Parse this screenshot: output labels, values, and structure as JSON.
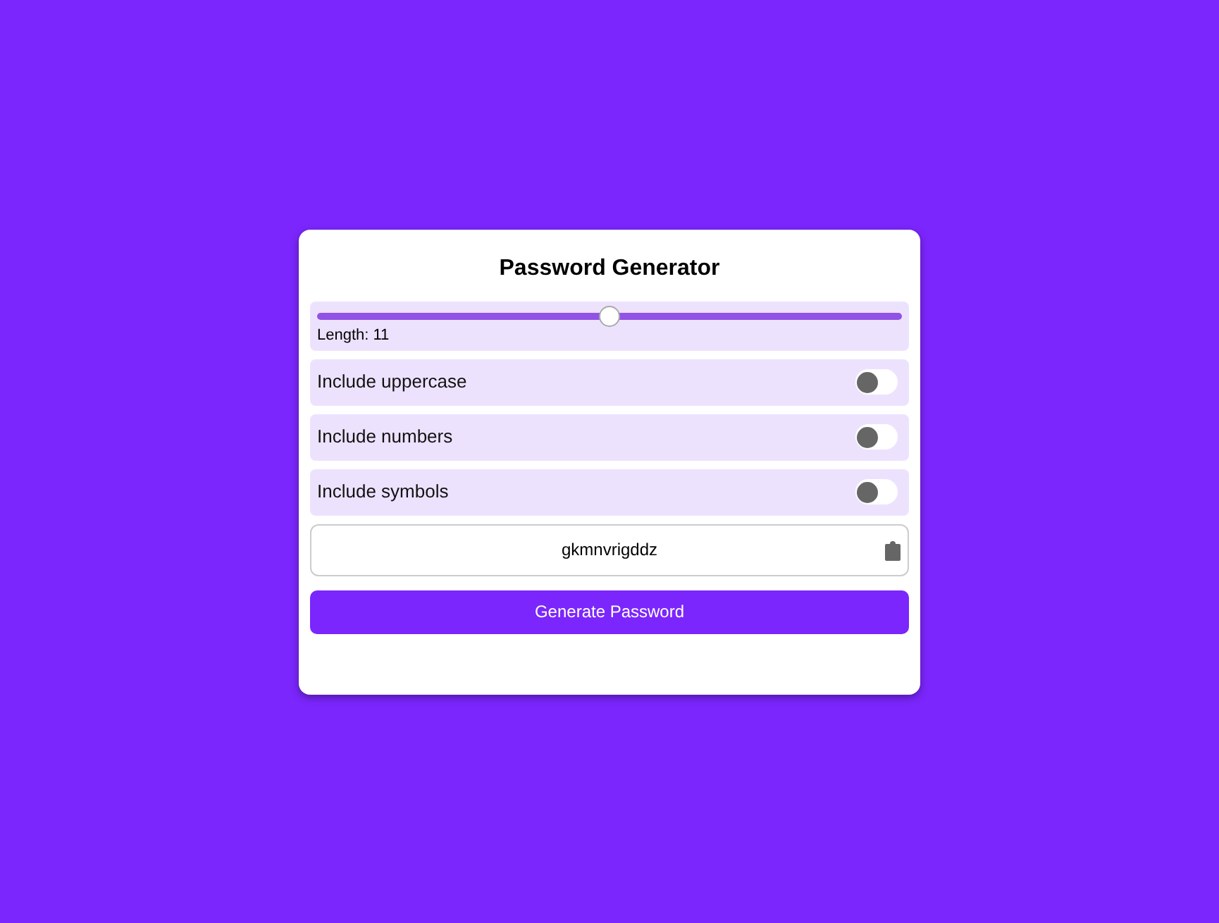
{
  "title": "Password Generator",
  "length": {
    "level": 0.5,
    "label": "Length: 11"
  },
  "options": [
    {
      "label": "Include uppercase",
      "on": false
    },
    {
      "label": "Include numbers",
      "on": false
    },
    {
      "label": "Include symbols",
      "on": false
    }
  ],
  "password": {
    "value": "gkmnvrigddz"
  },
  "button": "Generate Password"
}
